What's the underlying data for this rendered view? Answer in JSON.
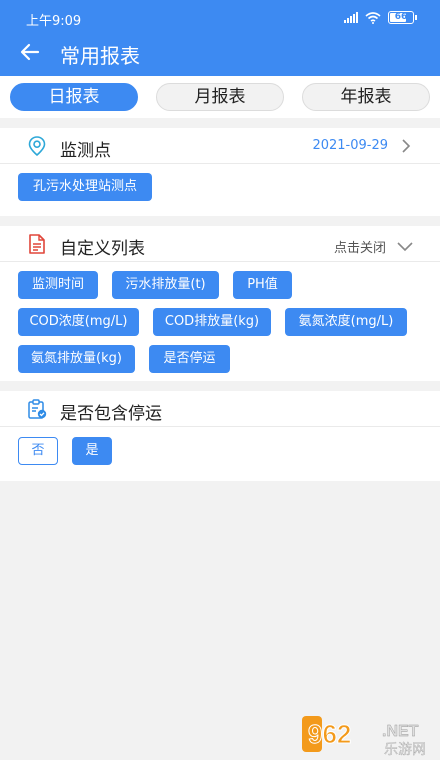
{
  "status_bar": {
    "time": "上午9:09",
    "battery": "66"
  },
  "header": {
    "back_icon": "arrow-left-icon",
    "title": "常用报表"
  },
  "tabs": [
    {
      "label": "日报表",
      "active": true
    },
    {
      "label": "月报表",
      "active": false
    },
    {
      "label": "年报表",
      "active": false
    }
  ],
  "monitor_point": {
    "icon": "location-pin-icon",
    "title": "监测点",
    "date": "2021-09-29",
    "selected": "孔污水处理站测点"
  },
  "custom_columns": {
    "icon": "document-icon",
    "title": "自定义列表",
    "toggle_label": "点击关闭",
    "columns": [
      "监测时间",
      "污水排放量(t)",
      "PH值",
      "COD浓度(mg/L)",
      "COD排放量(kg)",
      "氨氮浓度(mg/L)",
      "氨氮排放量(kg)",
      "是否停运"
    ]
  },
  "include_shutdown": {
    "icon": "clipboard-check-icon",
    "title": "是否包含停运",
    "options": [
      {
        "label": "否",
        "selected": false
      },
      {
        "label": "是",
        "selected": true
      }
    ]
  },
  "watermark": {
    "number": "962",
    "suffix": ".NET",
    "sub": "乐游网"
  },
  "colors": {
    "primary": "#3d8af2",
    "date": "#3d8af2",
    "document_icon": "#e0463a",
    "background": "#f2f2f2"
  }
}
